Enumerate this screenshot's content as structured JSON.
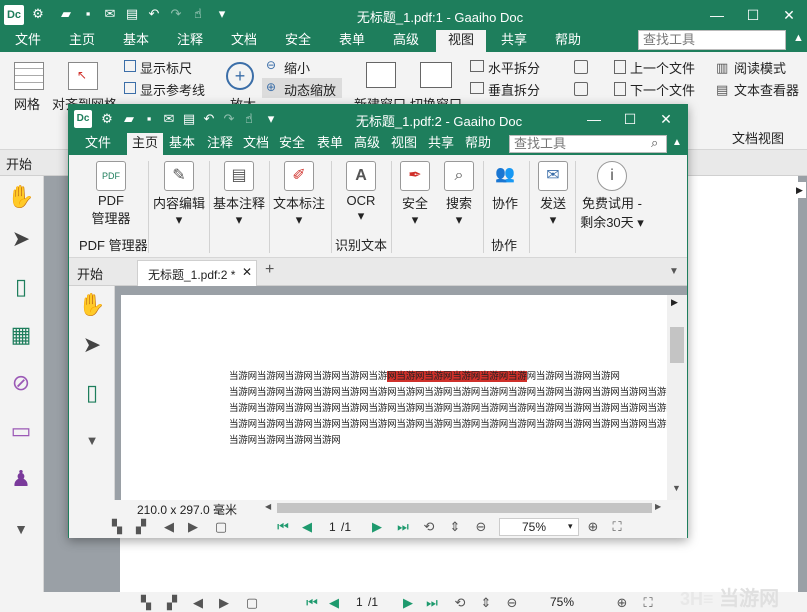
{
  "back_window": {
    "app_logo": "Dc",
    "title": "无标题_1.pdf:1 - Gaaiho Doc",
    "menu": [
      "文件",
      "主页",
      "基本",
      "注释",
      "文档",
      "安全",
      "表单",
      "高级",
      "视图",
      "共享",
      "帮助"
    ],
    "active_menu": "视图",
    "search_placeholder": "查找工具",
    "ribbon": {
      "grid": "网格",
      "align_grid": "对齐到网格",
      "show_ruler": "显示标尺",
      "show_guides": "显示参考线",
      "zoom_in": "放大",
      "zoom_out": "缩小",
      "dynamic_zoom": "动态缩放",
      "new_window": "新建窗口",
      "switch_window": "切换窗口",
      "split_h": "水平拆分",
      "split_v": "垂直拆分",
      "prev_doc": "上一个文件",
      "next_doc": "下一个文件",
      "read_mode": "阅读模式",
      "text_viewer": "文本查看器",
      "doc_view_group": "文档视图"
    },
    "start_label": "开始",
    "page_current": "1",
    "page_total": "/1",
    "zoom": "75%"
  },
  "front_window": {
    "app_logo": "Dc",
    "title": "无标题_1.pdf:2 - Gaaiho Doc",
    "menu": [
      "文件",
      "主页",
      "基本",
      "注释",
      "文档",
      "安全",
      "表单",
      "高级",
      "视图",
      "共享",
      "帮助"
    ],
    "active_menu": "主页",
    "search_placeholder": "查找工具",
    "ribbon": {
      "pdf_manager_top": "PDF",
      "pdf_manager_bottom": "管理器",
      "pdf_manager_group": "PDF 管理器",
      "content_edit": "内容编辑",
      "basic_comment": "基本注释",
      "text_mark": "文本标注",
      "ocr": "OCR",
      "ocr_group": "识别文本",
      "security": "安全",
      "search": "搜索",
      "collab": "协作",
      "collab_group": "协作",
      "send": "发送",
      "trial_top": "免费试用 -",
      "trial_bottom": "剩余30天"
    },
    "tab_start": "开始",
    "tab_doc": "无标题_1.pdf:2 *",
    "doc_lines": [
      {
        "pre": "当游网当游网当游网当游网当游网当游",
        "hl": "网当游网当游网当游网当游网当游",
        "post": "网当游网当游网当游网"
      },
      {
        "pre": "当游网当游网当游网当游网当游网当游网当游网当游网当游网当游网当游网当游网当游网当游网当游网当游网",
        "hl": "",
        "post": ""
      },
      {
        "pre": "当游网当游网当游网当游网当游网当游网当游网当游网当游网当游网当游网当游网当游网当游网当游网当游网",
        "hl": "",
        "post": ""
      },
      {
        "pre": "当游网当游网当游网当游网当游网当游网当游网当游网当游网当游网当游网当游网当游网当游网当游网当游网",
        "hl": "",
        "post": ""
      },
      {
        "pre": "当游网当游网当游网当游网",
        "hl": "",
        "post": ""
      }
    ],
    "page_size": "210.0 x 297.0 毫米",
    "page_current": "1",
    "page_total": "/1",
    "zoom": "75%"
  },
  "watermark": "当游网"
}
